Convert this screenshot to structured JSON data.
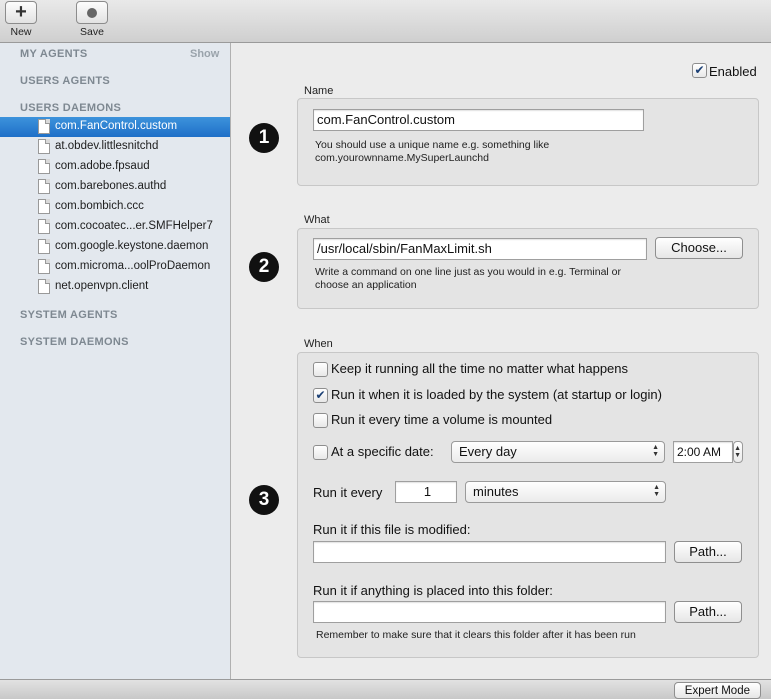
{
  "toolbar": {
    "new_label": "New",
    "save_label": "Save"
  },
  "sidebar": {
    "sections": {
      "my_agents": "MY AGENTS",
      "show": "Show",
      "users_agents": "USERS AGENTS",
      "users_daemons": "USERS DAEMONS",
      "system_agents": "SYSTEM AGENTS",
      "system_daemons": "SYSTEM DAEMONS"
    },
    "items": [
      "com.FanControl.custom",
      "at.obdev.littlesnitchd",
      "com.adobe.fpsaud",
      "com.barebones.authd",
      "com.bombich.ccc",
      "com.cocoatec...er.SMFHelper7",
      "com.google.keystone.daemon",
      "com.microma...oolProDaemon",
      "net.openvpn.client"
    ],
    "selected_index": 0
  },
  "main": {
    "enabled_label": "Enabled",
    "enabled_checked": true,
    "name": {
      "title": "Name",
      "value": "com.FanControl.custom",
      "hint_line1": "You should use a unique name e.g. something like",
      "hint_line2": "com.yourownname.MySuperLaunchd"
    },
    "what": {
      "title": "What",
      "value": "/usr/local/sbin/FanMaxLimit.sh",
      "choose_label": "Choose...",
      "hint_line1": "Write a command on one line just as you would in e.g. Terminal or",
      "hint_line2": "choose an application"
    },
    "when": {
      "title": "When",
      "keep_running": "Keep it running all the time no matter what happens",
      "keep_running_checked": false,
      "run_loaded": "Run it when it is loaded by the system (at startup or login)",
      "run_loaded_checked": true,
      "run_volume": "Run it every time a volume is mounted",
      "run_volume_checked": false,
      "specific_date": "At a specific date:",
      "specific_date_checked": false,
      "date_option": "Every day",
      "time_value": "2:00 AM",
      "run_every_label": "Run it every",
      "run_every_value": "1",
      "run_every_unit": "minutes",
      "file_modified_label": "Run it if this file is modified:",
      "file_modified_value": "",
      "path_label": "Path...",
      "folder_label": "Run it if anything is placed into this folder:",
      "folder_value": "",
      "folder_hint": "Remember to make sure that it clears this folder after it has been run"
    },
    "badges": [
      "1",
      "2",
      "3"
    ]
  },
  "bottom": {
    "expert_mode_label": "Expert Mode"
  },
  "colors": {
    "selection": "#1e6fc8",
    "sidebar_bg": "#e3e8ee",
    "window_bg": "#ececec"
  }
}
